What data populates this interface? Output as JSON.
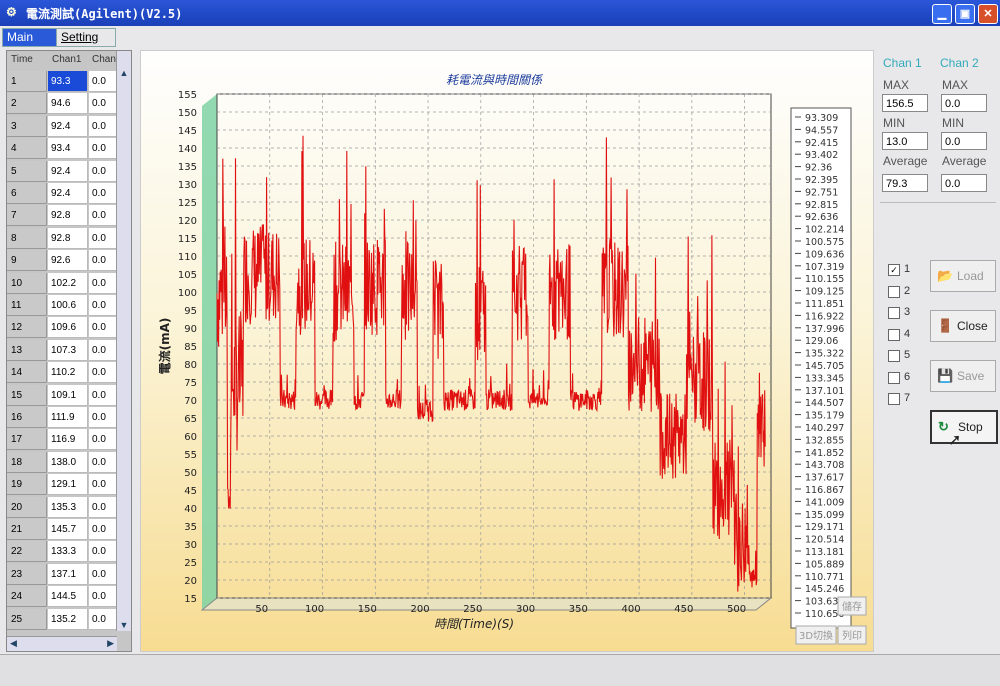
{
  "window": {
    "title": "電流測試(Agilent)(V2.5)",
    "controls": {
      "minimize": "▁",
      "maximize": "▣",
      "close": "✕"
    }
  },
  "tabs": [
    {
      "label": "Main"
    },
    {
      "label": "Setting"
    }
  ],
  "grid": {
    "headers": [
      "Time",
      "Chan1",
      "Chan"
    ],
    "rows": [
      {
        "time": "1",
        "c1": "93.3",
        "c2": "0.0"
      },
      {
        "time": "2",
        "c1": "94.6",
        "c2": "0.0"
      },
      {
        "time": "3",
        "c1": "92.4",
        "c2": "0.0"
      },
      {
        "time": "4",
        "c1": "93.4",
        "c2": "0.0"
      },
      {
        "time": "5",
        "c1": "92.4",
        "c2": "0.0"
      },
      {
        "time": "6",
        "c1": "92.4",
        "c2": "0.0"
      },
      {
        "time": "7",
        "c1": "92.8",
        "c2": "0.0"
      },
      {
        "time": "8",
        "c1": "92.8",
        "c2": "0.0"
      },
      {
        "time": "9",
        "c1": "92.6",
        "c2": "0.0"
      },
      {
        "time": "10",
        "c1": "102.2",
        "c2": "0.0"
      },
      {
        "time": "11",
        "c1": "100.6",
        "c2": "0.0"
      },
      {
        "time": "12",
        "c1": "109.6",
        "c2": "0.0"
      },
      {
        "time": "13",
        "c1": "107.3",
        "c2": "0.0"
      },
      {
        "time": "14",
        "c1": "110.2",
        "c2": "0.0"
      },
      {
        "time": "15",
        "c1": "109.1",
        "c2": "0.0"
      },
      {
        "time": "16",
        "c1": "111.9",
        "c2": "0.0"
      },
      {
        "time": "17",
        "c1": "116.9",
        "c2": "0.0"
      },
      {
        "time": "18",
        "c1": "138.0",
        "c2": "0.0"
      },
      {
        "time": "19",
        "c1": "129.1",
        "c2": "0.0"
      },
      {
        "time": "20",
        "c1": "135.3",
        "c2": "0.0"
      },
      {
        "time": "21",
        "c1": "145.7",
        "c2": "0.0"
      },
      {
        "time": "22",
        "c1": "133.3",
        "c2": "0.0"
      },
      {
        "time": "23",
        "c1": "137.1",
        "c2": "0.0"
      },
      {
        "time": "24",
        "c1": "144.5",
        "c2": "0.0"
      },
      {
        "time": "25",
        "c1": "135.2",
        "c2": "0.0"
      }
    ]
  },
  "chart_data": {
    "type": "line",
    "title": "耗電流與時間關係",
    "xlabel": "時間(Time)(S)",
    "ylabel": "電流(mA)",
    "xlim": [
      0,
      525
    ],
    "ylim": [
      15,
      155
    ],
    "x_ticks": [
      50,
      100,
      150,
      200,
      250,
      300,
      350,
      400,
      450,
      500
    ],
    "y_ticks": [
      15,
      20,
      25,
      30,
      35,
      40,
      45,
      50,
      55,
      60,
      65,
      70,
      75,
      80,
      85,
      90,
      95,
      100,
      105,
      110,
      115,
      120,
      125,
      130,
      135,
      140,
      145,
      150,
      155
    ],
    "grid": true,
    "color": "#e01010",
    "segments": [
      {
        "x0": 0,
        "x1": 10,
        "level": 100,
        "spread": 18
      },
      {
        "x0": 10,
        "x1": 13,
        "level": 42,
        "spread": 4
      },
      {
        "x0": 13,
        "x1": 25,
        "level": 75,
        "spread": 20
      },
      {
        "x0": 25,
        "x1": 60,
        "level": 105,
        "spread": 14
      },
      {
        "x0": 60,
        "x1": 75,
        "level": 70,
        "spread": 3
      },
      {
        "x0": 75,
        "x1": 93,
        "level": 102,
        "spread": 14
      },
      {
        "x0": 93,
        "x1": 110,
        "level": 70,
        "spread": 3
      },
      {
        "x0": 110,
        "x1": 130,
        "level": 100,
        "spread": 14
      },
      {
        "x0": 130,
        "x1": 140,
        "level": 70,
        "spread": 3
      },
      {
        "x0": 140,
        "x1": 160,
        "level": 102,
        "spread": 14
      },
      {
        "x0": 160,
        "x1": 175,
        "level": 70,
        "spread": 3
      },
      {
        "x0": 175,
        "x1": 190,
        "level": 100,
        "spread": 14
      },
      {
        "x0": 190,
        "x1": 205,
        "level": 67,
        "spread": 3
      },
      {
        "x0": 205,
        "x1": 215,
        "level": 95,
        "spread": 14
      },
      {
        "x0": 215,
        "x1": 245,
        "level": 70,
        "spread": 3
      },
      {
        "x0": 245,
        "x1": 255,
        "level": 95,
        "spread": 14
      },
      {
        "x0": 255,
        "x1": 280,
        "level": 70,
        "spread": 3
      },
      {
        "x0": 280,
        "x1": 295,
        "level": 100,
        "spread": 14
      },
      {
        "x0": 295,
        "x1": 315,
        "level": 70,
        "spread": 3
      },
      {
        "x0": 315,
        "x1": 335,
        "level": 100,
        "spread": 14
      },
      {
        "x0": 335,
        "x1": 365,
        "level": 70,
        "spread": 3
      },
      {
        "x0": 365,
        "x1": 390,
        "level": 100,
        "spread": 14
      },
      {
        "x0": 390,
        "x1": 420,
        "level": 80,
        "spread": 14
      },
      {
        "x0": 420,
        "x1": 445,
        "level": 60,
        "spread": 12
      },
      {
        "x0": 445,
        "x1": 470,
        "level": 75,
        "spread": 14
      },
      {
        "x0": 470,
        "x1": 490,
        "level": 45,
        "spread": 14
      },
      {
        "x0": 490,
        "x1": 505,
        "level": 30,
        "spread": 14
      },
      {
        "x0": 505,
        "x1": 512,
        "level": 20,
        "spread": 3
      },
      {
        "x0": 512,
        "x1": 520,
        "level": 65,
        "spread": 14
      }
    ],
    "legend_values": [
      "93.309",
      "94.557",
      "92.415",
      "93.402",
      "92.36",
      "92.395",
      "92.751",
      "92.815",
      "92.636",
      "102.214",
      "100.575",
      "109.636",
      "107.319",
      "110.155",
      "109.125",
      "111.851",
      "116.922",
      "137.996",
      "129.06",
      "135.322",
      "145.705",
      "133.345",
      "137.101",
      "144.507",
      "135.179",
      "140.297",
      "132.855",
      "141.852",
      "143.708",
      "137.617",
      "116.867",
      "141.009",
      "135.099",
      "129.171",
      "120.514",
      "113.181",
      "105.889",
      "110.771",
      "145.246",
      "103.630",
      "110.656"
    ],
    "buttons": {
      "save_img": "儲存",
      "toggle3d": "3D切換",
      "print": "列印"
    }
  },
  "right_panel": {
    "chan1_header": "Chan 1",
    "chan2_header": "Chan 2",
    "max_label": "MAX",
    "min_label": "MIN",
    "avg_label": "Average",
    "chan1": {
      "max": "156.5",
      "min": "13.0",
      "avg": "79.3"
    },
    "chan2": {
      "max": "0.0",
      "min": "0.0",
      "avg": "0.0"
    },
    "checkboxes": [
      {
        "label": "1",
        "mark": "✓"
      },
      {
        "label": "2",
        "mark": ""
      },
      {
        "label": "3",
        "mark": ""
      },
      {
        "label": "4",
        "mark": ""
      },
      {
        "label": "5",
        "mark": ""
      },
      {
        "label": "6",
        "mark": ""
      },
      {
        "label": "7",
        "mark": ""
      }
    ],
    "buttons": {
      "load": {
        "label": "Load",
        "icon": "📂"
      },
      "close": {
        "label": "Close",
        "icon": "🚪"
      },
      "save": {
        "label": "Save",
        "icon": "💾"
      },
      "stop": {
        "label": "Stop",
        "icon": "↻"
      }
    }
  }
}
